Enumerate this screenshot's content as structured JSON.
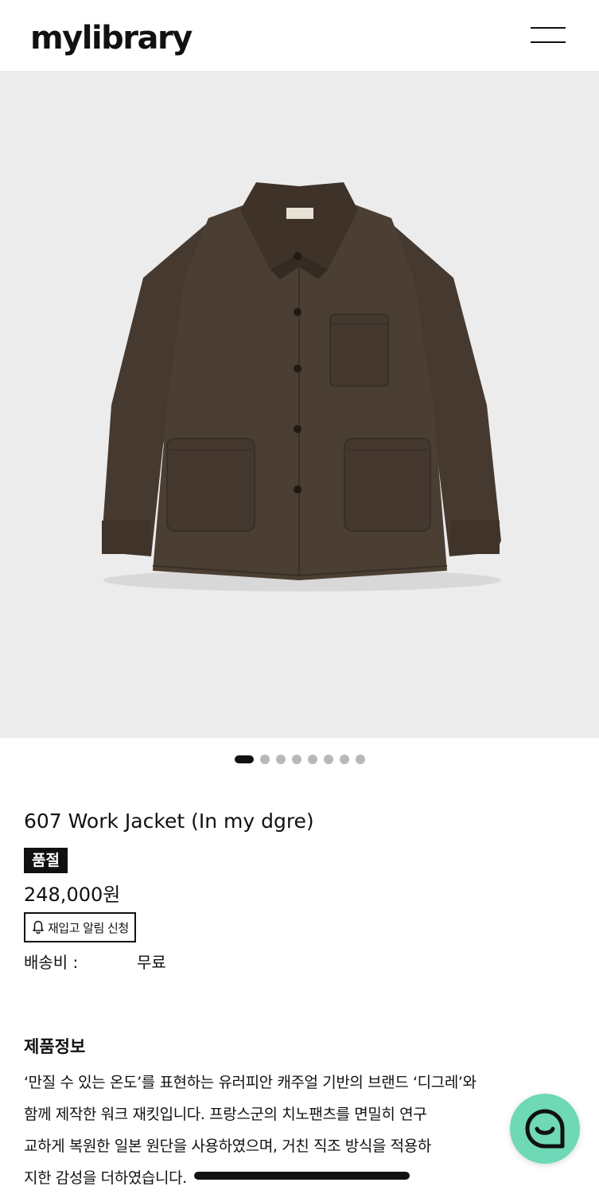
{
  "header": {
    "logo": "mylibrary",
    "menu_icon": "hamburger-icon"
  },
  "gallery": {
    "image": "dark brown cotton work jacket with shirt collar, five buttons, one chest patch pocket and two lower patch pockets",
    "total_slides": 8,
    "active_index": 0,
    "background": "#ececec",
    "jacket_color": "#4a3c31"
  },
  "product": {
    "name": "607 Work Jacket (In my dgre)",
    "badge": "품절",
    "price": "248,000원",
    "restock_button": "재입고 알림 신청",
    "restock_icon": "bell-icon",
    "shipping_label": "배송비 :",
    "shipping_value": "무료"
  },
  "info": {
    "title": "제품정보",
    "lines": [
      "‘만질 수 있는 온도’를 표현하는 유러피안 캐주얼 기반의 브랜드 ‘디그레’와",
      "함께 제작한 워크 재킷입니다. 프랑스군의 치노팬츠를 면밀히 연구",
      "교하게 복원한 일본 원단을 사용하였으며, 거친 직조 방식을 적용하",
      "지한 감성을 더하였습니다."
    ]
  },
  "chat": {
    "icon": "chat-bubble-icon",
    "color": "#6fd8b6"
  }
}
